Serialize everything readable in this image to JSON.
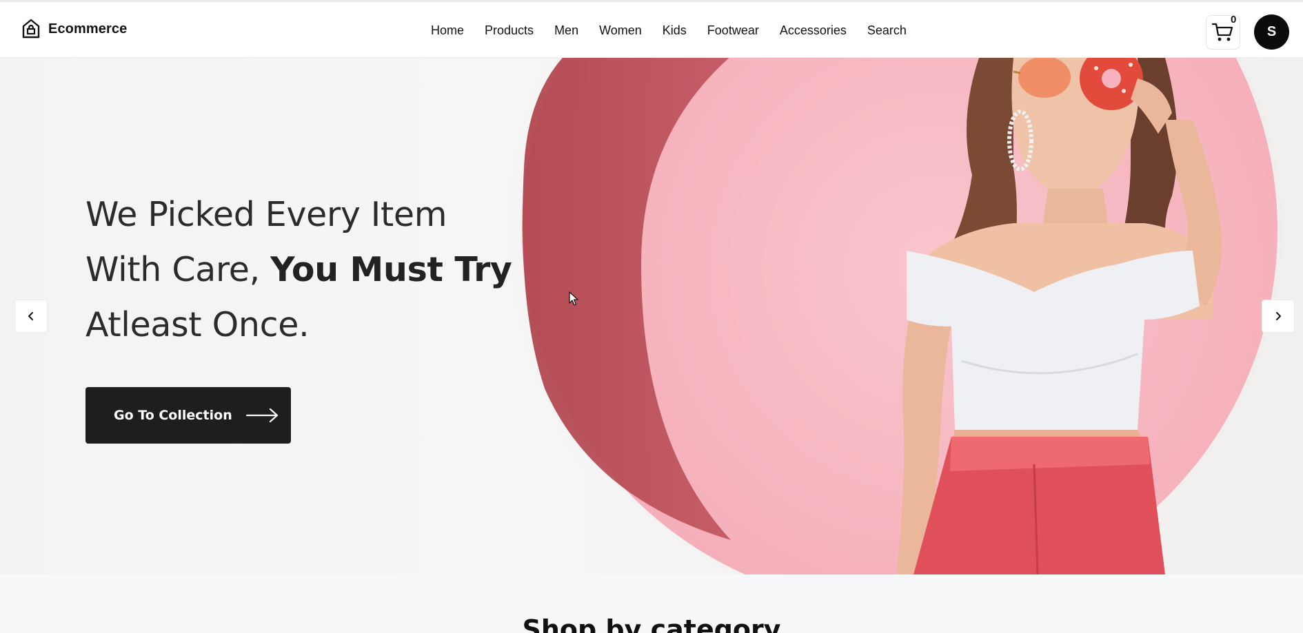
{
  "brand": {
    "name": "Ecommerce",
    "icon": "shopping-bag-logo-icon"
  },
  "nav": {
    "items": [
      "Home",
      "Products",
      "Men",
      "Women",
      "Kids",
      "Footwear",
      "Accessories",
      "Search"
    ]
  },
  "cart": {
    "count": "0",
    "icon": "shopping-cart-icon"
  },
  "user": {
    "avatar_letter": "S"
  },
  "hero": {
    "headline_line1": "We Picked Every Item",
    "headline_line2_prefix": "With Care, ",
    "headline_line2_bold": "You Must Try",
    "headline_line3": "Atleast Once.",
    "cta_label": "Go To Collection",
    "prev_icon": "chevron-left-icon",
    "next_icon": "chevron-right-icon",
    "colors": {
      "circle": "#f7b9c3",
      "shadow": "#b44a52",
      "skirt": "#e2555b",
      "cta_bg": "#1e1e1e"
    }
  },
  "section": {
    "title": "Shop by category"
  }
}
